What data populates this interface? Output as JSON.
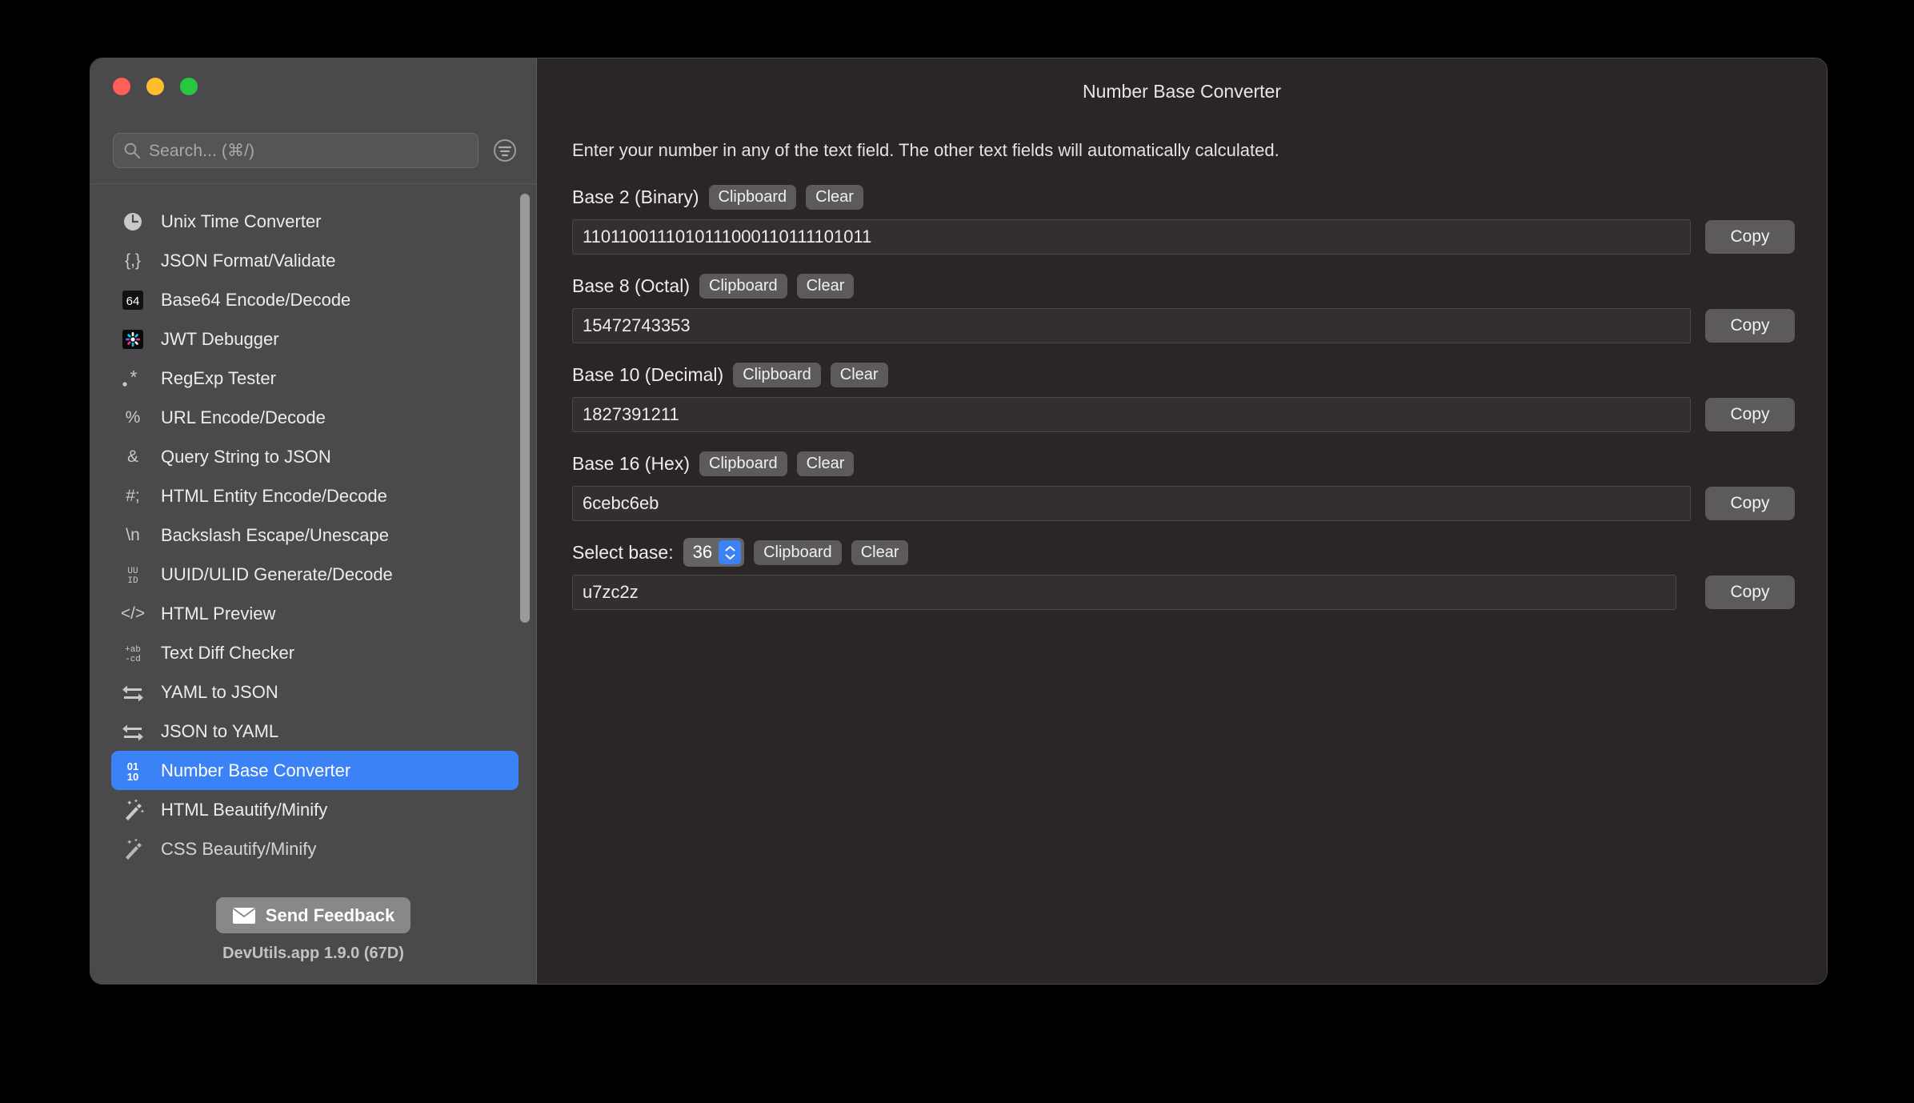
{
  "window": {
    "traffic_lights": [
      "close",
      "minimize",
      "maximize"
    ],
    "colors": {
      "close": "#ff5f57",
      "minimize": "#febc2e",
      "maximize": "#28c840",
      "accent": "#3b82f6"
    }
  },
  "sidebar": {
    "search": {
      "placeholder": "Search... (⌘/)",
      "icon": "search-icon"
    },
    "filter_icon": "filter-icon",
    "items": [
      {
        "label": "Unix Time Converter",
        "icon": "clock-icon",
        "selected": false
      },
      {
        "label": "JSON Format/Validate",
        "icon": "braces-icon",
        "selected": false
      },
      {
        "label": "Base64 Encode/Decode",
        "icon": "base64-icon",
        "selected": false
      },
      {
        "label": "JWT Debugger",
        "icon": "jwt-icon",
        "selected": false
      },
      {
        "label": "RegExp Tester",
        "icon": "asterisk-icon",
        "selected": false
      },
      {
        "label": "URL Encode/Decode",
        "icon": "percent-icon",
        "selected": false
      },
      {
        "label": "Query String to JSON",
        "icon": "ampersand-icon",
        "selected": false
      },
      {
        "label": "HTML Entity Encode/Decode",
        "icon": "hash-semicolon-icon",
        "selected": false
      },
      {
        "label": "Backslash Escape/Unescape",
        "icon": "backslash-n-icon",
        "selected": false
      },
      {
        "label": "UUID/ULID Generate/Decode",
        "icon": "uuid-icon",
        "selected": false
      },
      {
        "label": "HTML Preview",
        "icon": "code-tag-icon",
        "selected": false
      },
      {
        "label": "Text Diff Checker",
        "icon": "diff-icon",
        "selected": false
      },
      {
        "label": "YAML to JSON",
        "icon": "swap-arrows-icon",
        "selected": false
      },
      {
        "label": "JSON to YAML",
        "icon": "swap-arrows-icon",
        "selected": false
      },
      {
        "label": "Number Base Converter",
        "icon": "binary-icon",
        "selected": true
      },
      {
        "label": "HTML Beautify/Minify",
        "icon": "magic-wand-icon",
        "selected": false
      },
      {
        "label": "CSS Beautify/Minify",
        "icon": "magic-wand-icon",
        "selected": false
      }
    ],
    "feedback_button": "Send Feedback",
    "version": "DevUtils.app 1.9.0 (67D)"
  },
  "main": {
    "title": "Number Base Converter",
    "intro": "Enter your number in any of the text field. The other text fields will automatically calculated.",
    "clipboard_label": "Clipboard",
    "clear_label": "Clear",
    "copy_label": "Copy",
    "select_base_label": "Select base:",
    "selected_base": "36",
    "rows": [
      {
        "label": "Base 2 (Binary)",
        "value": "1101100111010111000110111101011"
      },
      {
        "label": "Base 8 (Octal)",
        "value": "15472743353"
      },
      {
        "label": "Base 10 (Decimal)",
        "value": "1827391211"
      },
      {
        "label": "Base 16 (Hex)",
        "value": "6cebc6eb"
      },
      {
        "label": "Base 36",
        "value": "u7zc2z"
      }
    ]
  }
}
